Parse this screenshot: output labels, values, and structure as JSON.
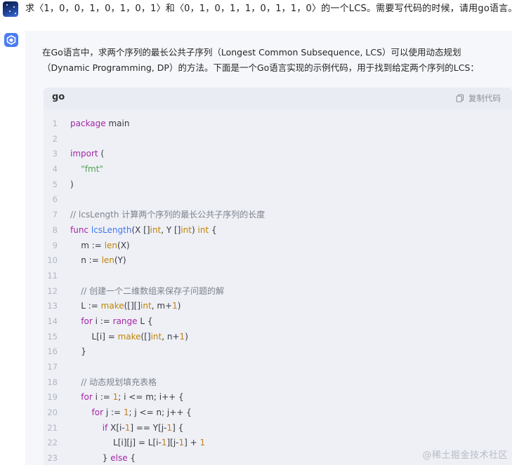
{
  "user": {
    "message": "求〈1，0，0，1，0，1，0，1〉和〈0，1，0，1，1，0，1，1，0〉的一个LCS。需要写代码的时候，请用go语言。"
  },
  "assistant": {
    "intro": "在Go语言中，求两个序列的最长公共子序列（Longest Common Subsequence, LCS）可以使用动态规划（Dynamic Programming, DP）的方法。下面是一个Go语言实现的示例代码，用于找到给定两个序列的LCS："
  },
  "code_block": {
    "language": "go",
    "copy_label": "复制代码",
    "lines": [
      {
        "n": "1",
        "t": "package main"
      },
      {
        "n": "2",
        "t": ""
      },
      {
        "n": "3",
        "t": "import ("
      },
      {
        "n": "4",
        "t": "    \"fmt\""
      },
      {
        "n": "5",
        "t": ")"
      },
      {
        "n": "6",
        "t": ""
      },
      {
        "n": "7",
        "t": "// lcsLength 计算两个序列的最长公共子序列的长度"
      },
      {
        "n": "8",
        "t": "func lcsLength(X []int, Y []int) int {"
      },
      {
        "n": "9",
        "t": "    m := len(X)"
      },
      {
        "n": "10",
        "t": "    n := len(Y)"
      },
      {
        "n": "11",
        "t": ""
      },
      {
        "n": "12",
        "t": "    // 创建一个二维数组来保存子问题的解"
      },
      {
        "n": "13",
        "t": "    L := make([][]int, m+1)"
      },
      {
        "n": "14",
        "t": "    for i := range L {"
      },
      {
        "n": "15",
        "t": "        L[i] = make([]int, n+1)"
      },
      {
        "n": "16",
        "t": "    }"
      },
      {
        "n": "17",
        "t": ""
      },
      {
        "n": "18",
        "t": "    // 动态规划填充表格"
      },
      {
        "n": "19",
        "t": "    for i := 1; i <= m; i++ {"
      },
      {
        "n": "20",
        "t": "        for j := 1; j <= n; j++ {"
      },
      {
        "n": "21",
        "t": "            if X[i-1] == Y[j-1] {"
      },
      {
        "n": "22",
        "t": "                L[i][j] = L[i-1][j-1] + 1"
      },
      {
        "n": "23",
        "t": "            } else {"
      }
    ]
  },
  "watermark": "@稀土掘金技术社区",
  "colors": {
    "keyword": "#a626a4",
    "function": "#4078f2",
    "string": "#50a14f",
    "comment": "#7d828c",
    "number": "#c67d1b",
    "accent": "#4b7cf4"
  }
}
